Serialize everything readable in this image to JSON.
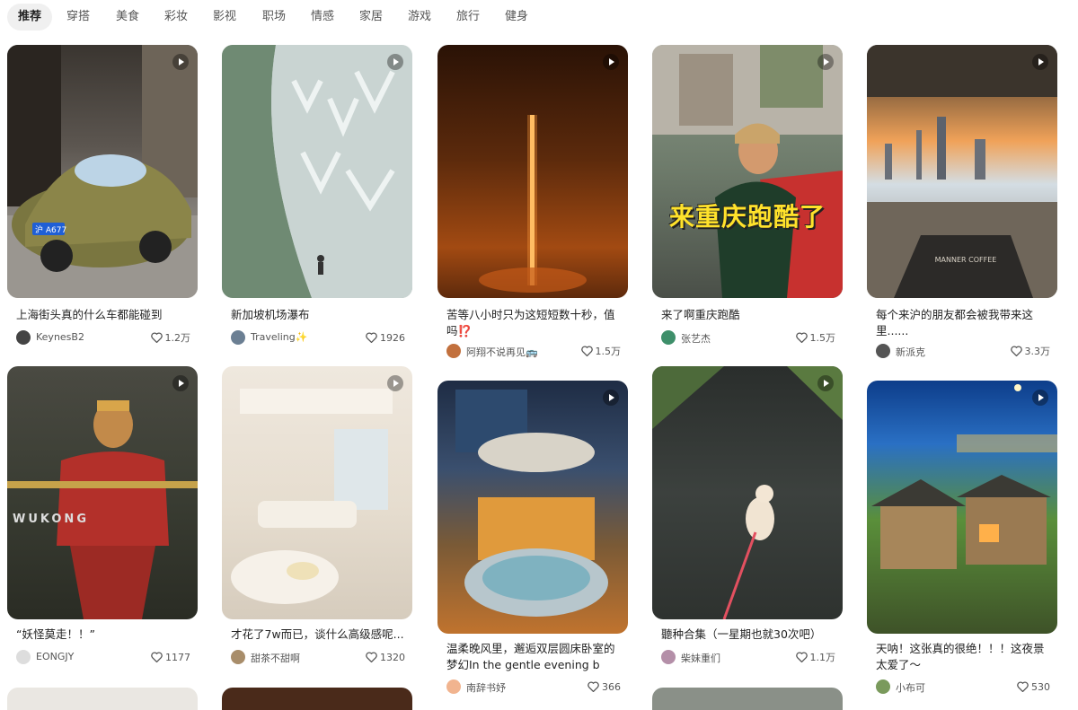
{
  "tabs": [
    "推荐",
    "穿搭",
    "美食",
    "彩妆",
    "影视",
    "职场",
    "情感",
    "家居",
    "游戏",
    "旅行",
    "健身"
  ],
  "cards": [
    {
      "title": "上海街头真的什么车都能碰到",
      "author": "KeynesB2",
      "likes": "1.2万",
      "plate": "沪 A677",
      "icon": "video-play-icon",
      "avatar_color": "#444"
    },
    {
      "title": "新加坡机场瀑布",
      "author": "Traveling✨",
      "likes": "1926",
      "icon": "video-play-icon",
      "avatar_color": "#6b7f93"
    },
    {
      "title": "苦等八小时只为这短短数十秒，值吗⁉️",
      "author": "阿翔不说再见🚌",
      "likes": "1.5万",
      "icon": "video-play-icon",
      "avatar_color": "#c2703d"
    },
    {
      "title": "来了啊重庆跑酷",
      "author": "张艺杰",
      "likes": "1.5万",
      "overlay": "来重庆跑酷了",
      "icon": "video-play-icon",
      "avatar_color": "#3e8f6a"
    },
    {
      "title": "每个来沪的朋友都会被我带来这里......",
      "author": "新派克",
      "likes": "3.3万",
      "sign": "MANNER COFFEE",
      "icon": "video-play-icon",
      "avatar_color": "#555"
    },
    {
      "title": "“妖怪莫走！！”",
      "author": "EONGJY",
      "likes": "1177",
      "overlay": "WUKONG",
      "icon": "video-play-icon",
      "avatar_color": "#ddd"
    },
    {
      "title": "才花了7w而已，谈什么高级感呢...",
      "author": "甜茶不甜啊",
      "likes": "1320",
      "icon": "video-play-icon",
      "avatar_color": "#a88d6a"
    },
    {
      "title": "温柔晚风里，邂逅双层圆床卧室的梦幻In the gentle evening b",
      "author": "南辞书妤",
      "likes": "366",
      "icon": "video-play-icon",
      "avatar_color": "#f1b48f"
    },
    {
      "title": "聽种合集（一星期也就30次吧）",
      "author": "柴妹重们",
      "likes": "1.1万",
      "icon": "video-play-icon",
      "avatar_color": "#b48fa8"
    },
    {
      "title": "天呐！这张真的很绝！！！这夜景太爱了～",
      "author": "小布可",
      "likes": "530",
      "icon": "video-play-icon",
      "avatar_color": "#7a9a5c"
    }
  ]
}
